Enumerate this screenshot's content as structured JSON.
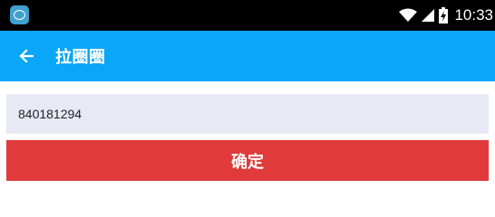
{
  "status_bar": {
    "time": "10:33",
    "app_icon": "app-notification-icon",
    "wifi_icon": "wifi-icon",
    "signal_icon": "cell-signal-icon",
    "battery_icon": "battery-icon"
  },
  "app_bar": {
    "back_icon": "back-arrow-icon",
    "title": "拉圈圈"
  },
  "form": {
    "input_value": "840181294",
    "confirm_label": "确定"
  },
  "colors": {
    "status_bar": "#000000",
    "app_bar": "#0aa6f7",
    "input_background": "#e7e9f5",
    "confirm_button": "#e03a3a"
  }
}
